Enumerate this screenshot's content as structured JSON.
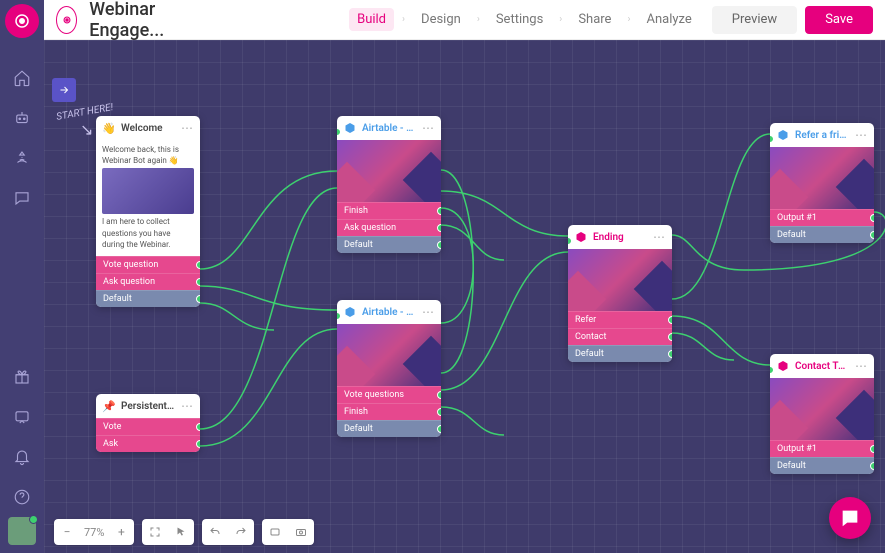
{
  "header": {
    "title": "Webinar Engage...",
    "tabs": [
      "Build",
      "Design",
      "Settings",
      "Share",
      "Analyze"
    ],
    "active_tab": "Build",
    "preview_label": "Preview",
    "save_label": "Save"
  },
  "rail": {
    "logo": "landbot-logo",
    "icons": [
      "home-icon",
      "robot-icon",
      "broadcast-icon",
      "chat-icon"
    ],
    "bottom_icons": [
      "gift-icon",
      "message-icon",
      "bell-icon",
      "help-icon"
    ]
  },
  "canvas": {
    "start_label": "START HERE!",
    "expand_icon": "expand-icon"
  },
  "toolbar": {
    "zoom": "77%",
    "icons": [
      "minus-icon",
      "plus-icon",
      "fit-icon",
      "cursor-icon",
      "undo-icon",
      "redo-icon",
      "screenshot-icon",
      "camera-icon"
    ]
  },
  "intercom": {
    "icon": "intercom-icon"
  },
  "nodes": {
    "welcome": {
      "icon": "👋",
      "title": "Welcome",
      "greeting": "Welcome back, this is Webinar Bot again 👋",
      "body2": "I am here to collect questions you have during the Webinar.",
      "outputs": [
        "Vote question",
        "Ask question",
        "Default"
      ]
    },
    "menu": {
      "icon": "📌",
      "title": "Persistent Menu",
      "outputs": [
        "Vote",
        "Ask"
      ]
    },
    "vote": {
      "icon": "cube-icon",
      "title": "Airtable - Vote",
      "outputs": [
        "Finish",
        "Ask question",
        "Default"
      ]
    },
    "ask": {
      "icon": "cube-icon",
      "title": "Airtable - Ask",
      "outputs": [
        "Vote questions",
        "Finish",
        "Default"
      ]
    },
    "ending": {
      "icon": "cube-icon",
      "title": "Ending",
      "outputs": [
        "Refer",
        "Contact",
        "Default"
      ]
    },
    "refer": {
      "icon": "cube-icon",
      "title": "Refer a friend",
      "outputs": [
        "Output #1",
        "Default"
      ]
    },
    "contact": {
      "icon": "cube-icon",
      "title": "Contact Team",
      "outputs": [
        "Output #1",
        "Default"
      ]
    }
  },
  "colors": {
    "accent": "#e6007e",
    "connector": "#3dd16f",
    "row_pink": "#e6488e",
    "row_blue": "#7a8aae"
  }
}
